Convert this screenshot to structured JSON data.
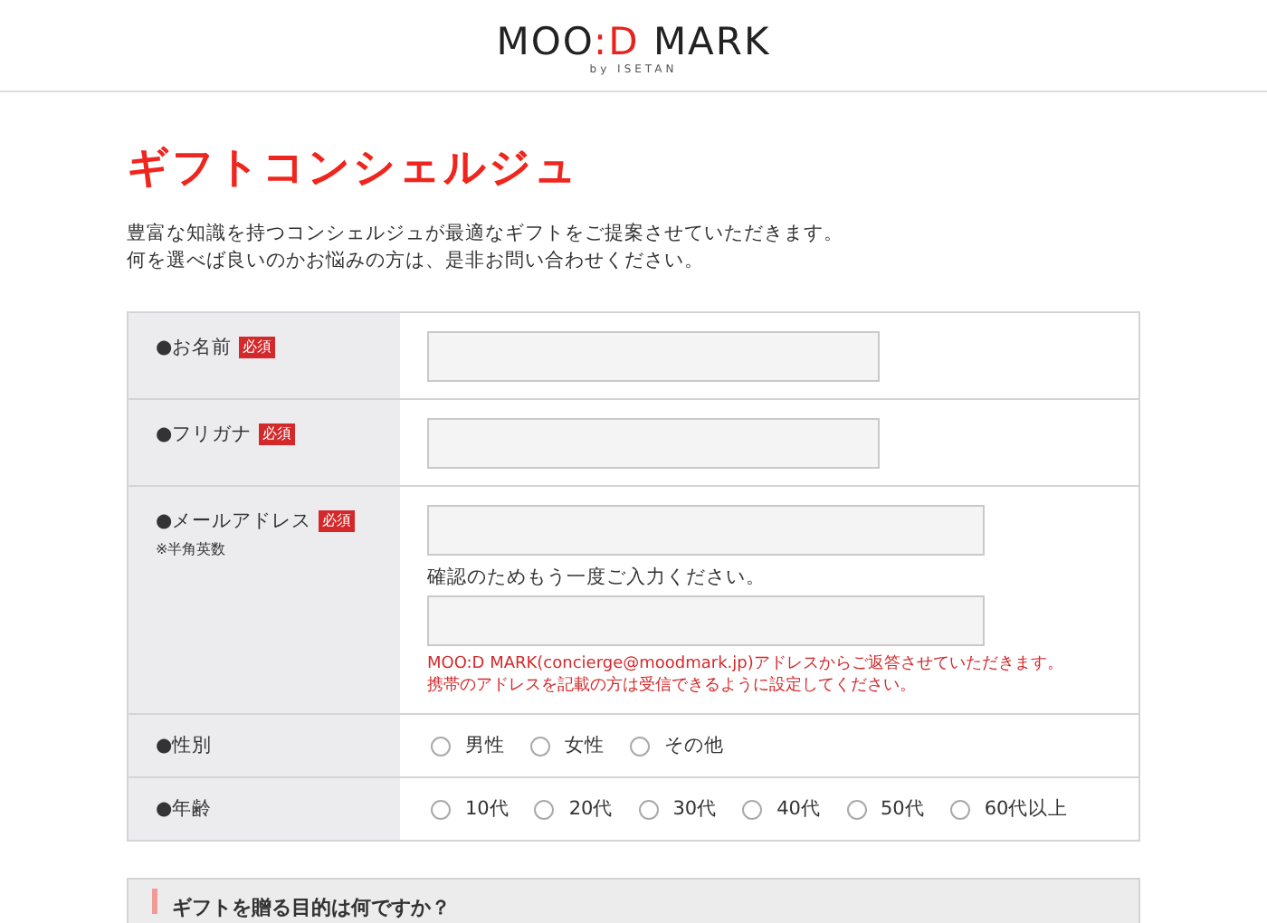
{
  "header": {
    "logo_left": "MOO",
    "logo_accent": ":D",
    "logo_right": " MARK",
    "logo_sub": "by ISETAN"
  },
  "title": "ギフトコンシェルジュ",
  "intro": [
    "豊富な知識を持つコンシェルジュが最適なギフトをご提案させていただきます。",
    "何を選べば良いのかお悩みの方は、是非お問い合わせください。"
  ],
  "fields": [
    {
      "kind": "text",
      "label": "●お名前",
      "required": "必須"
    },
    {
      "kind": "text",
      "label": "●フリガナ",
      "required": "必須"
    },
    {
      "kind": "email",
      "label": "●メールアドレス",
      "required": "必須",
      "note": "※半角英数",
      "confirm_label": "確認のためもう一度ご入力ください。",
      "notice": [
        "MOO:D MARK(concierge@moodmark.jp)アドレスからご返答させていただきます。",
        "携帯のアドレスを記載の方は受信できるように設定してください。"
      ]
    },
    {
      "kind": "radio",
      "label": "●性別",
      "options": [
        {
          "label": "男性",
          "selected": false
        },
        {
          "label": "女性",
          "selected": false
        },
        {
          "label": "その他",
          "selected": false
        }
      ]
    },
    {
      "kind": "radio",
      "label": "●年齢",
      "options": [
        {
          "label": "10代",
          "selected": false
        },
        {
          "label": "20代",
          "selected": false
        },
        {
          "label": "30代",
          "selected": false
        },
        {
          "label": "40代",
          "selected": false
        },
        {
          "label": "50代",
          "selected": false
        },
        {
          "label": "60代以上",
          "selected": false
        }
      ]
    }
  ],
  "section": {
    "heading": "ギフトを贈る目的は何ですか？"
  }
}
